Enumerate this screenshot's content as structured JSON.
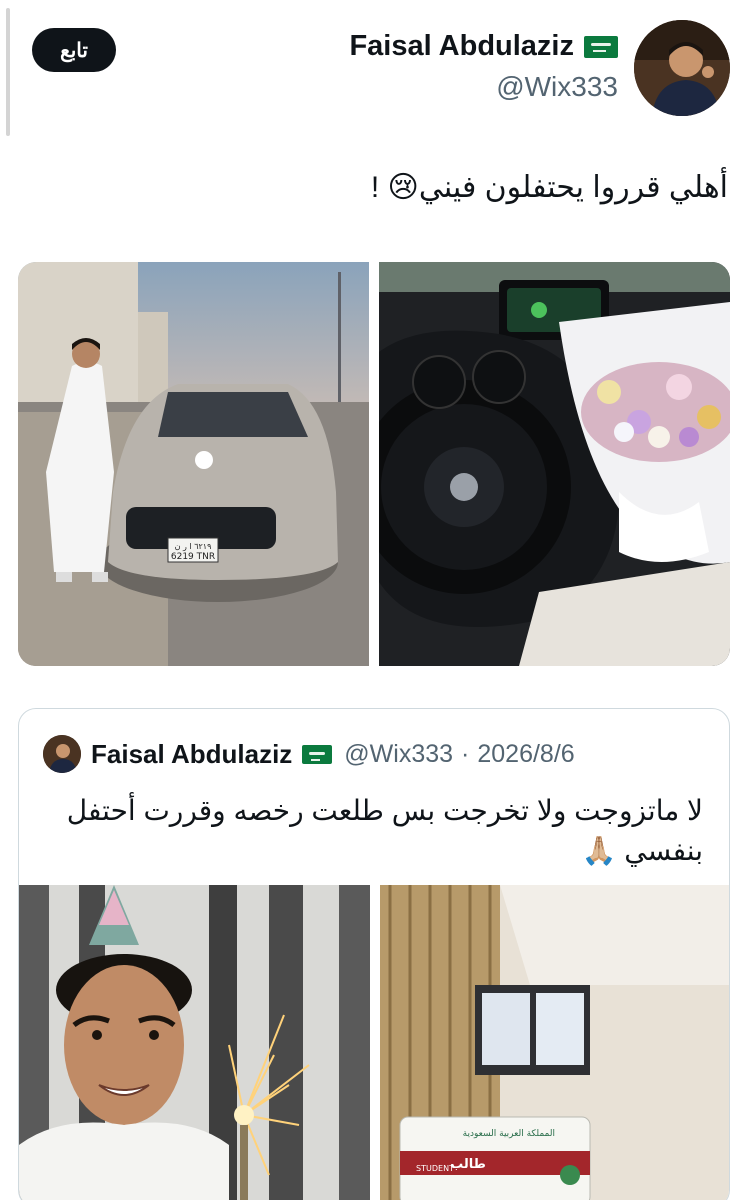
{
  "author": {
    "name": "Faisal Abdulaziz",
    "handle": "@Wix333",
    "follow_label": "تابع"
  },
  "tweet": {
    "text": "أهلي قرروا يحتفلون فيني😢 !"
  },
  "quoted": {
    "name": "Faisal Abdulaziz",
    "handle": "@Wix333",
    "separator": "·",
    "date": "2026/8/6",
    "text": "لا ماتزوجت ولا تخرجت بس طلعت رخصه وقررت أحتفل بنفسي 🙏🏼"
  },
  "media": {
    "plate_top": "٦٢١٩ ا ر ن",
    "plate_bottom": "6219 TNR",
    "card_top": "المملكة العربية السعودية",
    "card_label": "طالب",
    "card_student": "STUDENT"
  },
  "colors": {
    "text": "#0f1419",
    "secondary": "#536471",
    "border": "#cfd9de",
    "follow_bg": "#0f1419",
    "flag_green": "#0b7a3e"
  },
  "icons": [
    "saudi-flag-icon",
    "avatar-photo"
  ]
}
